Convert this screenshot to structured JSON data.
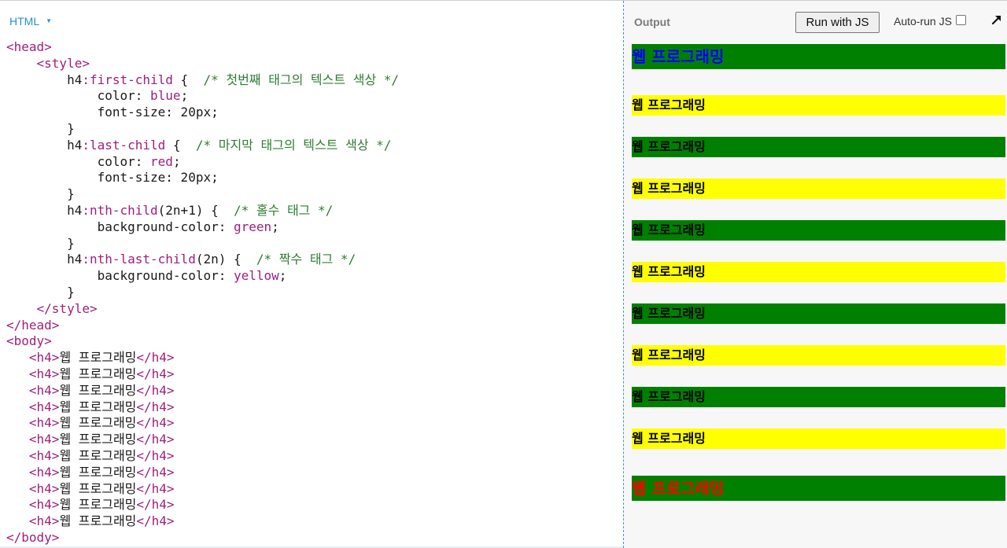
{
  "editor": {
    "language_tab": "HTML",
    "code_lines": [
      [
        [
          "tag",
          "<head>"
        ]
      ],
      [
        [
          "text",
          "    "
        ],
        [
          "tag",
          "<style>"
        ]
      ],
      [
        [
          "text",
          "        h4"
        ],
        [
          "pseudo",
          ":first-child"
        ],
        [
          "text",
          " {  "
        ],
        [
          "comment",
          "/* 첫번째 태그의 텍스트 색상 */"
        ]
      ],
      [
        [
          "text",
          "            color: "
        ],
        [
          "val",
          "blue"
        ],
        [
          "text",
          ";"
        ]
      ],
      [
        [
          "text",
          "            font-size: 20px;"
        ]
      ],
      [
        [
          "text",
          "        }"
        ]
      ],
      [
        [
          "text",
          "        h4"
        ],
        [
          "pseudo",
          ":last-child"
        ],
        [
          "text",
          " {  "
        ],
        [
          "comment",
          "/* 마지막 태그의 텍스트 색상 */"
        ]
      ],
      [
        [
          "text",
          "            color: "
        ],
        [
          "val",
          "red"
        ],
        [
          "text",
          ";"
        ]
      ],
      [
        [
          "text",
          "            font-size: 20px;"
        ]
      ],
      [
        [
          "text",
          "        }"
        ]
      ],
      [
        [
          "text",
          "        h4"
        ],
        [
          "pseudo",
          ":nth-child"
        ],
        [
          "text",
          "(2n+1) {  "
        ],
        [
          "comment",
          "/* 홀수 태그 */"
        ]
      ],
      [
        [
          "text",
          "            background-color: "
        ],
        [
          "val",
          "green"
        ],
        [
          "text",
          ";"
        ]
      ],
      [
        [
          "text",
          "        }"
        ]
      ],
      [
        [
          "text",
          "        h4"
        ],
        [
          "pseudo",
          ":nth-last-child"
        ],
        [
          "text",
          "(2n) {  "
        ],
        [
          "comment",
          "/* 짝수 태그 */"
        ]
      ],
      [
        [
          "text",
          "            background-color: "
        ],
        [
          "val",
          "yellow"
        ],
        [
          "text",
          ";"
        ]
      ],
      [
        [
          "text",
          "        }"
        ]
      ],
      [
        [
          "text",
          "    "
        ],
        [
          "tag",
          "</style>"
        ]
      ],
      [
        [
          "tag",
          "</head>"
        ]
      ],
      [
        [
          "tag",
          "<body>"
        ]
      ],
      [
        [
          "text",
          "   "
        ],
        [
          "tag",
          "<h4>"
        ],
        [
          "text",
          "웹 프로그래밍"
        ],
        [
          "tag",
          "</h4>"
        ]
      ],
      [
        [
          "text",
          "   "
        ],
        [
          "tag",
          "<h4>"
        ],
        [
          "text",
          "웹 프로그래밍"
        ],
        [
          "tag",
          "</h4>"
        ]
      ],
      [
        [
          "text",
          "   "
        ],
        [
          "tag",
          "<h4>"
        ],
        [
          "text",
          "웹 프로그래밍"
        ],
        [
          "tag",
          "</h4>"
        ]
      ],
      [
        [
          "text",
          "   "
        ],
        [
          "tag",
          "<h4>"
        ],
        [
          "text",
          "웹 프로그래밍"
        ],
        [
          "tag",
          "</h4>"
        ]
      ],
      [
        [
          "text",
          "   "
        ],
        [
          "tag",
          "<h4>"
        ],
        [
          "text",
          "웹 프로그래밍"
        ],
        [
          "tag",
          "</h4>"
        ]
      ],
      [
        [
          "text",
          "   "
        ],
        [
          "tag",
          "<h4>"
        ],
        [
          "text",
          "웹 프로그래밍"
        ],
        [
          "tag",
          "</h4>"
        ]
      ],
      [
        [
          "text",
          "   "
        ],
        [
          "tag",
          "<h4>"
        ],
        [
          "text",
          "웹 프로그래밍"
        ],
        [
          "tag",
          "</h4>"
        ]
      ],
      [
        [
          "text",
          "   "
        ],
        [
          "tag",
          "<h4>"
        ],
        [
          "text",
          "웹 프로그래밍"
        ],
        [
          "tag",
          "</h4>"
        ]
      ],
      [
        [
          "text",
          "   "
        ],
        [
          "tag",
          "<h4>"
        ],
        [
          "text",
          "웹 프로그래밍"
        ],
        [
          "tag",
          "</h4>"
        ]
      ],
      [
        [
          "text",
          "   "
        ],
        [
          "tag",
          "<h4>"
        ],
        [
          "text",
          "웹 프로그래밍"
        ],
        [
          "tag",
          "</h4>"
        ]
      ],
      [
        [
          "text",
          "   "
        ],
        [
          "tag",
          "<h4>"
        ],
        [
          "text",
          "웹 프로그래밍"
        ],
        [
          "tag",
          "</h4>"
        ]
      ],
      [
        [
          "tag",
          "</body>"
        ]
      ]
    ]
  },
  "output": {
    "label": "Output",
    "run_button": "Run with JS",
    "autorun_label": "Auto-run JS",
    "autorun_checked": false,
    "expand_icon": "expand-arrow-icon"
  },
  "preview": {
    "items": [
      {
        "text": "웹 프로그래밍",
        "color": "#0000ff",
        "background": "#008000",
        "large": true
      },
      {
        "text": "웹 프로그래밍",
        "color": "#000000",
        "background": "#ffff00",
        "large": false
      },
      {
        "text": "웹 프로그래밍",
        "color": "#000000",
        "background": "#008000",
        "large": false
      },
      {
        "text": "웹 프로그래밍",
        "color": "#000000",
        "background": "#ffff00",
        "large": false
      },
      {
        "text": "웹 프로그래밍",
        "color": "#000000",
        "background": "#008000",
        "large": false
      },
      {
        "text": "웹 프로그래밍",
        "color": "#000000",
        "background": "#ffff00",
        "large": false
      },
      {
        "text": "웹 프로그래밍",
        "color": "#000000",
        "background": "#008000",
        "large": false
      },
      {
        "text": "웹 프로그래밍",
        "color": "#000000",
        "background": "#ffff00",
        "large": false
      },
      {
        "text": "웹 프로그래밍",
        "color": "#000000",
        "background": "#008000",
        "large": false
      },
      {
        "text": "웹 프로그래밍",
        "color": "#000000",
        "background": "#ffff00",
        "large": false
      },
      {
        "text": "웹 프로그래밍",
        "color": "#ff0000",
        "background": "#008000",
        "large": true
      }
    ]
  }
}
